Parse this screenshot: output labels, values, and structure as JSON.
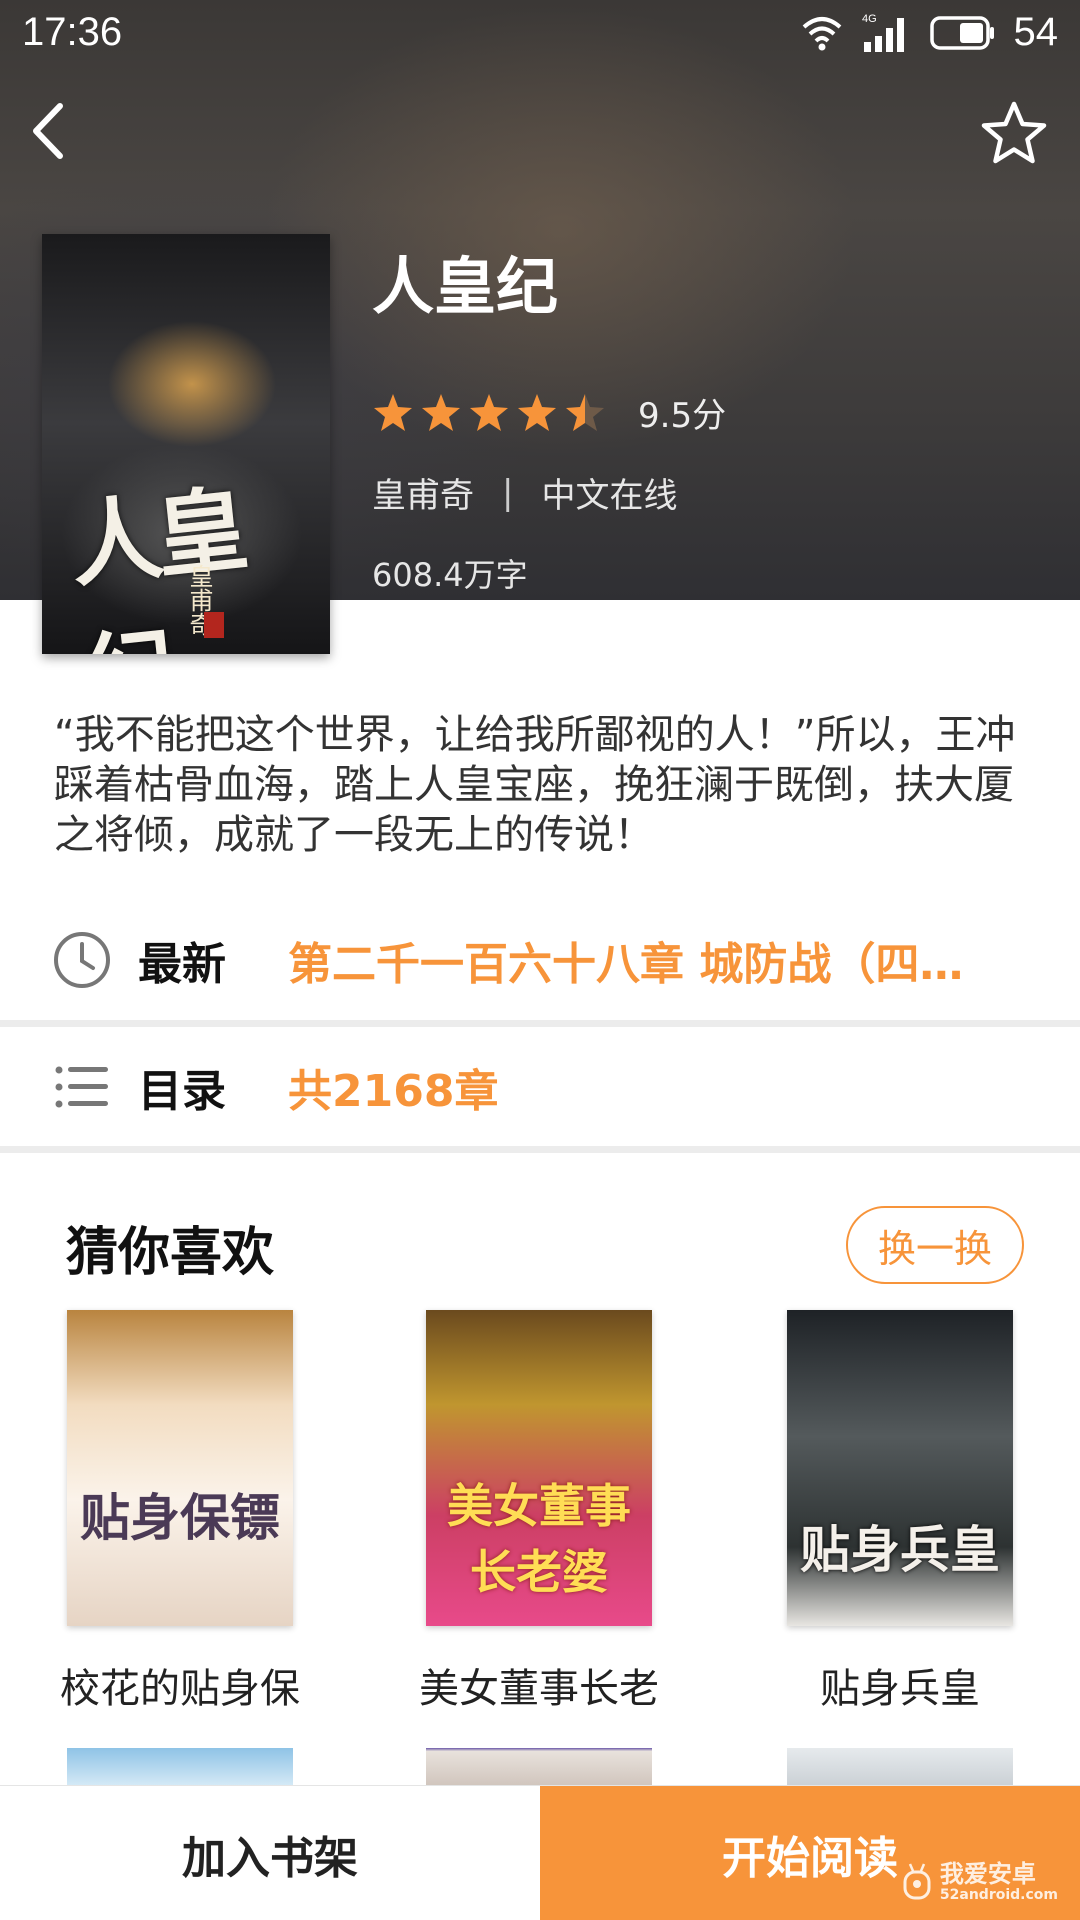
{
  "status_bar": {
    "time": "17:36",
    "battery": "54",
    "network": "4G"
  },
  "book": {
    "title": "人皇纪",
    "rating_value": 4.5,
    "rating_max": 5,
    "score": "9.5分",
    "author": "皇甫奇",
    "separator": "|",
    "source": "中文在线",
    "word_count": "608.4万字",
    "cover_title": "人皇纪",
    "cover_author": "皇甫奇"
  },
  "description": "“我不能把这个世界，让给我所鄙视的人！”所以，王冲踩着枯骨血海，踏上人皇宝座，挽狂澜于既倒，扶大厦之将倾，成就了一段无上的传说！",
  "latest": {
    "label": "最新",
    "value": "第二千一百六十八章 城防战（四…"
  },
  "toc": {
    "label": "目录",
    "value": "共2168章"
  },
  "recommendations": {
    "title": "猜你喜欢",
    "refresh_label": "换一换",
    "items": [
      {
        "name": "校花的贴身保",
        "cover_text": "贴身保镖"
      },
      {
        "name": "美女董事长老",
        "cover_text": "美女董事长老婆"
      },
      {
        "name": "贴身兵皇",
        "cover_text": "贴身兵皇"
      }
    ]
  },
  "bottom": {
    "add_shelf": "加入书架",
    "start_reading": "开始阅读"
  },
  "watermark": {
    "text": "我爱安卓",
    "sub": "52android.com"
  },
  "colors": {
    "accent": "#f7943a",
    "star": "#f7943a"
  }
}
